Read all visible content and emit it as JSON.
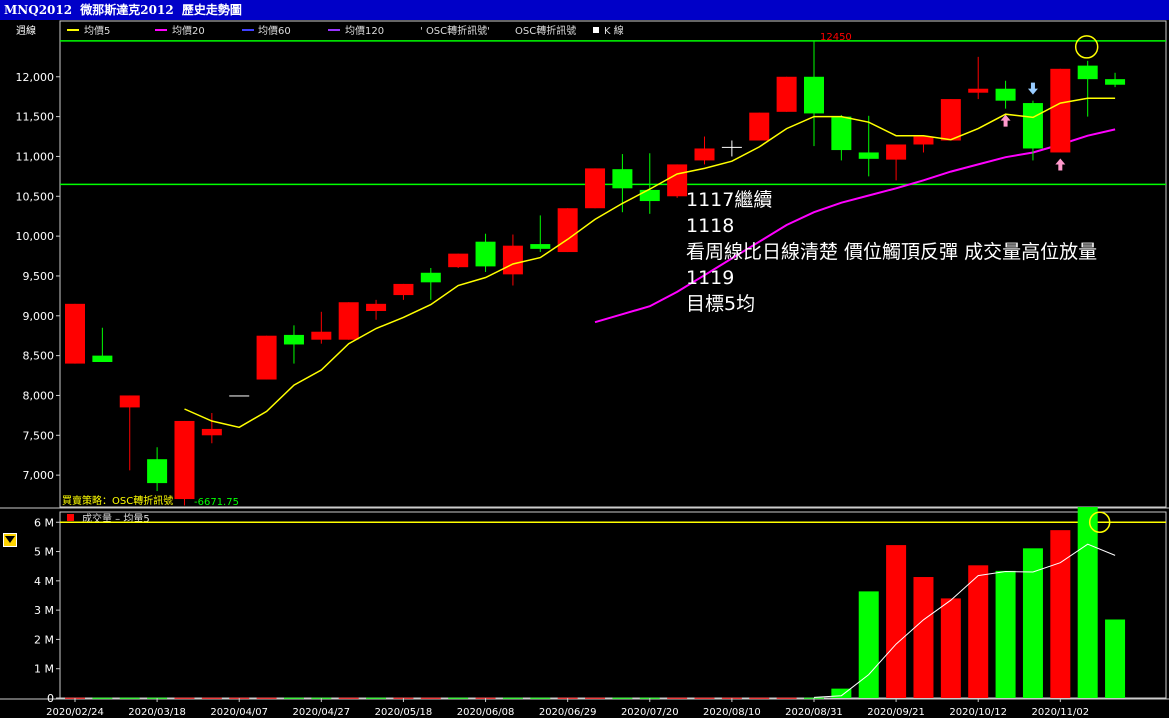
{
  "window": {
    "title_code": "MNQ2012",
    "title_name": "微那斯達克2012",
    "title_suffix": "歷史走勢圖"
  },
  "legend": {
    "period": "週線",
    "ma5": "均價5",
    "ma20": "均價20",
    "ma60": "均價60",
    "ma120": "均價120",
    "osc1": "OSC轉折訊號",
    "osc2": "OSC轉折訊號",
    "kline": "K 線",
    "strategy": "買賣策略：OSC轉折訊號",
    "strategy_value": "6671.75",
    "vol_label": "成交量",
    "vol_ma": "均量5"
  },
  "colors": {
    "up": "#ff0000",
    "down": "#00ff00",
    "ma5": "#ffff00",
    "ma20": "#ff00ff",
    "ma60": "#4040ff",
    "ma120": "#9933ff",
    "axis": "#cccccc",
    "hline": "#00ff00",
    "vol_hline": "#ffff00"
  },
  "annotations": {
    "peak_label": "12450",
    "note_lines": [
      "1117繼續",
      "1118",
      "看周線比日線清楚  價位觸頂反彈 成交量高位放量",
      "1119",
      "目標5均"
    ]
  },
  "chart_data": [
    {
      "type": "candlestick",
      "title": "",
      "ylim": [
        6600,
        12700
      ],
      "y_ticks": [
        "7,000",
        "7,500",
        "8,000",
        "8,500",
        "9,000",
        "9,500",
        "10,000",
        "10,500",
        "11,000",
        "11,500",
        "12,000"
      ],
      "y_tick_values": [
        7000,
        7500,
        8000,
        8500,
        9000,
        9500,
        10000,
        10500,
        11000,
        11500,
        12000
      ],
      "x_tick_labels": [
        "2020/02/24",
        "2020/03/18",
        "2020/04/07",
        "2020/04/27",
        "2020/05/18",
        "2020/06/08",
        "2020/06/29",
        "2020/07/20",
        "2020/08/10",
        "2020/08/31",
        "2020/09/21",
        "2020/10/12",
        "2020/11/02"
      ],
      "x_tick_index": [
        0,
        3,
        6,
        9,
        12,
        15,
        18,
        21,
        24,
        27,
        30,
        33,
        36
      ],
      "horizontal_lines": [
        12450,
        10650
      ],
      "candles": [
        {
          "o": 8400,
          "h": 9150,
          "l": 8400,
          "c": 9150
        },
        {
          "o": 8500,
          "h": 8850,
          "l": 8420,
          "c": 8420
        },
        {
          "o": 7850,
          "h": 8000,
          "l": 7060,
          "c": 8000
        },
        {
          "o": 7200,
          "h": 7350,
          "l": 6800,
          "c": 6900
        },
        {
          "o": 6700,
          "h": 7680,
          "l": 6620,
          "c": 7680
        },
        {
          "o": 7500,
          "h": 7780,
          "l": 7400,
          "c": 7580
        },
        {
          "o": 8000,
          "h": 8000,
          "l": 8000,
          "c": 8000
        },
        {
          "o": 8200,
          "h": 8750,
          "l": 8200,
          "c": 8750
        },
        {
          "o": 8760,
          "h": 8880,
          "l": 8400,
          "c": 8640
        },
        {
          "o": 8700,
          "h": 9050,
          "l": 8650,
          "c": 8800
        },
        {
          "o": 8700,
          "h": 9170,
          "l": 8700,
          "c": 9170
        },
        {
          "o": 9060,
          "h": 9200,
          "l": 8950,
          "c": 9150
        },
        {
          "o": 9260,
          "h": 9400,
          "l": 9200,
          "c": 9400
        },
        {
          "o": 9540,
          "h": 9600,
          "l": 9200,
          "c": 9420
        },
        {
          "o": 9610,
          "h": 9780,
          "l": 9600,
          "c": 9780
        },
        {
          "o": 9930,
          "h": 10030,
          "l": 9550,
          "c": 9620
        },
        {
          "o": 9520,
          "h": 10020,
          "l": 9380,
          "c": 9880
        },
        {
          "o": 9900,
          "h": 10260,
          "l": 9800,
          "c": 9840
        },
        {
          "o": 9800,
          "h": 10350,
          "l": 9800,
          "c": 10350
        },
        {
          "o": 10350,
          "h": 10850,
          "l": 10350,
          "c": 10850
        },
        {
          "o": 10840,
          "h": 11030,
          "l": 10300,
          "c": 10600
        },
        {
          "o": 10580,
          "h": 11040,
          "l": 10280,
          "c": 10440
        },
        {
          "o": 10500,
          "h": 10900,
          "l": 10480,
          "c": 10900
        },
        {
          "o": 10950,
          "h": 11250,
          "l": 10900,
          "c": 11100
        },
        {
          "o": 11120,
          "h": 11200,
          "l": 11000,
          "c": 11120
        },
        {
          "o": 11200,
          "h": 11550,
          "l": 11200,
          "c": 11550
        },
        {
          "o": 11560,
          "h": 12000,
          "l": 11560,
          "c": 12000
        },
        {
          "o": 12000,
          "h": 12450,
          "l": 11130,
          "c": 11540
        },
        {
          "o": 11500,
          "h": 11520,
          "l": 10950,
          "c": 11080
        },
        {
          "o": 11050,
          "h": 11510,
          "l": 10750,
          "c": 10970
        },
        {
          "o": 10960,
          "h": 11150,
          "l": 10700,
          "c": 11150
        },
        {
          "o": 11150,
          "h": 11250,
          "l": 11050,
          "c": 11250
        },
        {
          "o": 11200,
          "h": 11720,
          "l": 11200,
          "c": 11720
        },
        {
          "o": 11800,
          "h": 12250,
          "l": 11720,
          "c": 11850
        },
        {
          "o": 11850,
          "h": 11950,
          "l": 11600,
          "c": 11700
        },
        {
          "o": 11670,
          "h": 11700,
          "l": 10950,
          "c": 11100
        },
        {
          "o": 11050,
          "h": 12100,
          "l": 11050,
          "c": 12100
        },
        {
          "o": 12140,
          "h": 12200,
          "l": 11500,
          "c": 11970
        },
        {
          "o": 11970,
          "h": 12050,
          "l": 11870,
          "c": 11900
        }
      ],
      "ma5": [
        null,
        null,
        null,
        null,
        7830,
        7680,
        7600,
        7800,
        8130,
        8320,
        8650,
        8840,
        8980,
        9140,
        9380,
        9480,
        9650,
        9730,
        9960,
        10210,
        10410,
        10590,
        10780,
        10850,
        10940,
        11120,
        11350,
        11500,
        11500,
        11430,
        11260,
        11260,
        11210,
        11350,
        11530,
        11490,
        11670,
        11730,
        11730
      ],
      "ma20": [
        null,
        null,
        null,
        null,
        null,
        null,
        null,
        null,
        null,
        null,
        null,
        null,
        null,
        null,
        null,
        null,
        null,
        null,
        null,
        8920,
        9020,
        9120,
        9300,
        9510,
        9720,
        9930,
        10140,
        10300,
        10420,
        10510,
        10600,
        10700,
        10810,
        10900,
        10990,
        11050,
        11150,
        11260,
        11340
      ],
      "markers": [
        {
          "index": 34,
          "kind": "up-arrow",
          "color": "#ff99cc"
        },
        {
          "index": 35,
          "kind": "down-arrow",
          "color": "#99ccff"
        },
        {
          "index": 36,
          "kind": "up-arrow",
          "color": "#ff99cc"
        }
      ]
    },
    {
      "type": "bar",
      "title": "",
      "ylim": [
        0,
        6.35
      ],
      "y_ticks": [
        "0",
        "1 M",
        "2 M",
        "3 M",
        "4 M",
        "5 M",
        "6 M"
      ],
      "y_tick_values": [
        0,
        1,
        2,
        3,
        4,
        5,
        6
      ],
      "horizontal_lines": [
        6
      ],
      "unit": "M",
      "values": [
        0.01,
        0.01,
        0.01,
        0.01,
        0.01,
        0.01,
        0.01,
        0.01,
        0.01,
        0.01,
        0.01,
        0.01,
        0.01,
        0.01,
        0.01,
        0.01,
        0.01,
        0.01,
        0.01,
        0.01,
        0.01,
        0.01,
        0.01,
        0.01,
        0.01,
        0.01,
        0.01,
        0.01,
        0.32,
        3.64,
        5.22,
        4.13,
        3.4,
        4.53,
        4.34,
        5.11,
        5.73,
        6.52,
        2.68
      ],
      "up": [
        true,
        false,
        false,
        false,
        true,
        true,
        true,
        true,
        false,
        false,
        true,
        false,
        true,
        true,
        false,
        true,
        false,
        false,
        true,
        true,
        false,
        false,
        true,
        true,
        true,
        true,
        true,
        false,
        false,
        false,
        true,
        true,
        true,
        true,
        false,
        false,
        true,
        false,
        false
      ],
      "ma5": [
        null,
        null,
        null,
        null,
        null,
        null,
        null,
        null,
        null,
        null,
        null,
        null,
        null,
        null,
        null,
        null,
        null,
        null,
        null,
        null,
        null,
        null,
        null,
        null,
        null,
        null,
        null,
        0.02,
        0.08,
        0.8,
        1.84,
        2.67,
        3.34,
        4.18,
        4.32,
        4.3,
        4.62,
        5.25,
        4.87
      ]
    }
  ]
}
